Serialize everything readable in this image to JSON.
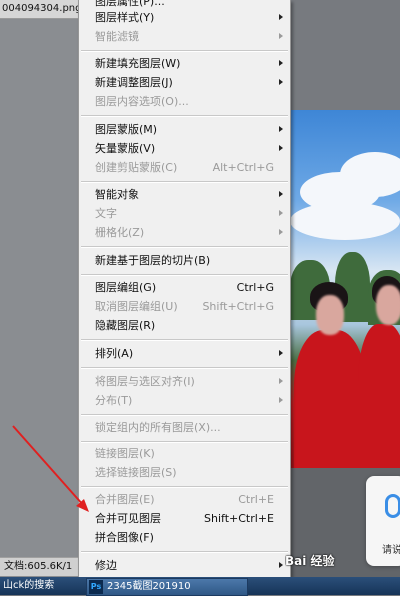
{
  "document": {
    "tab_title": "004094304.png",
    "status": "文档:605.6K/1"
  },
  "menu": {
    "items": [
      {
        "label": "图层属性(P)...",
        "shortcut": "",
        "enabled": true,
        "submenu": false
      },
      {
        "label": "图层样式(Y)",
        "shortcut": "",
        "enabled": true,
        "submenu": true
      },
      {
        "label": "智能滤镜",
        "shortcut": "",
        "enabled": false,
        "submenu": true
      },
      {
        "label": "新建填充图层(W)",
        "shortcut": "",
        "enabled": true,
        "submenu": true
      },
      {
        "label": "新建调整图层(J)",
        "shortcut": "",
        "enabled": true,
        "submenu": true
      },
      {
        "label": "图层内容选项(O)...",
        "shortcut": "",
        "enabled": false,
        "submenu": false
      },
      {
        "label": "图层蒙版(M)",
        "shortcut": "",
        "enabled": true,
        "submenu": true
      },
      {
        "label": "矢量蒙版(V)",
        "shortcut": "",
        "enabled": true,
        "submenu": true
      },
      {
        "label": "创建剪贴蒙版(C)",
        "shortcut": "Alt+Ctrl+G",
        "enabled": false,
        "submenu": false
      },
      {
        "label": "智能对象",
        "shortcut": "",
        "enabled": true,
        "submenu": true
      },
      {
        "label": "文字",
        "shortcut": "",
        "enabled": false,
        "submenu": true
      },
      {
        "label": "栅格化(Z)",
        "shortcut": "",
        "enabled": false,
        "submenu": true
      },
      {
        "label": "新建基于图层的切片(B)",
        "shortcut": "",
        "enabled": true,
        "submenu": false
      },
      {
        "label": "图层编组(G)",
        "shortcut": "Ctrl+G",
        "enabled": true,
        "submenu": false
      },
      {
        "label": "取消图层编组(U)",
        "shortcut": "Shift+Ctrl+G",
        "enabled": false,
        "submenu": false
      },
      {
        "label": "隐藏图层(R)",
        "shortcut": "",
        "enabled": true,
        "submenu": false
      },
      {
        "label": "排列(A)",
        "shortcut": "",
        "enabled": true,
        "submenu": true
      },
      {
        "label": "将图层与选区对齐(I)",
        "shortcut": "",
        "enabled": false,
        "submenu": true
      },
      {
        "label": "分布(T)",
        "shortcut": "",
        "enabled": false,
        "submenu": true
      },
      {
        "label": "锁定组内的所有图层(X)...",
        "shortcut": "",
        "enabled": false,
        "submenu": false
      },
      {
        "label": "链接图层(K)",
        "shortcut": "",
        "enabled": false,
        "submenu": false
      },
      {
        "label": "选择链接图层(S)",
        "shortcut": "",
        "enabled": false,
        "submenu": false
      },
      {
        "label": "合并图层(E)",
        "shortcut": "Ctrl+E",
        "enabled": false,
        "submenu": false
      },
      {
        "label": "合并可见图层",
        "shortcut": "Shift+Ctrl+E",
        "enabled": true,
        "submenu": false
      },
      {
        "label": "拼合图像(F)",
        "shortcut": "",
        "enabled": true,
        "submenu": false
      },
      {
        "label": "修边",
        "shortcut": "",
        "enabled": true,
        "submenu": true
      }
    ]
  },
  "taskbar": {
    "left_text": "山ck的搜索",
    "app_text": "2345截图201910"
  },
  "popup": {
    "text": "请说"
  },
  "watermark": "Bai 经验",
  "colors": {
    "annotation_arrow": "#e02020",
    "menu_background": "#f0f0f0",
    "disabled_text": "#9a9a9a"
  }
}
